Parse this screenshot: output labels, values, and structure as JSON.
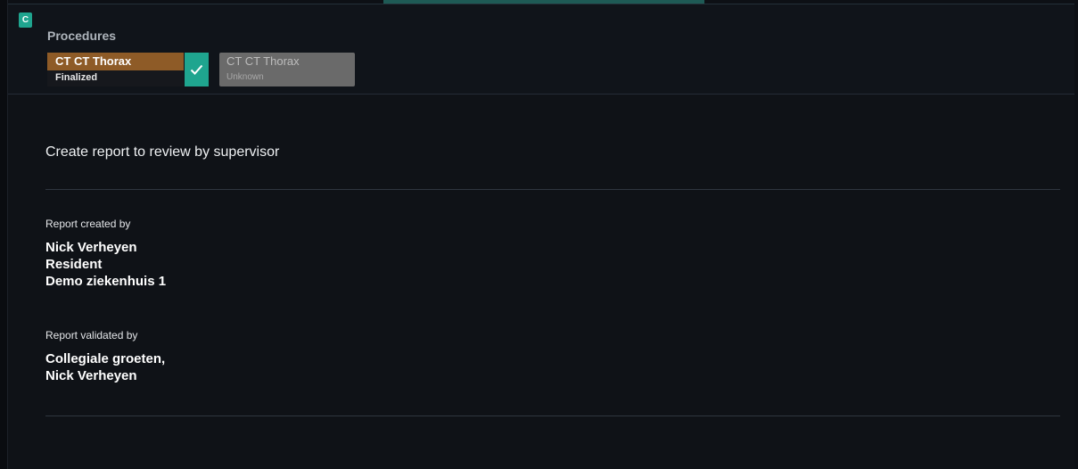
{
  "header": {
    "badge_letter": "C",
    "procedures_title": "Procedures",
    "procedures": [
      {
        "name": "CT CT Thorax",
        "status": "Finalized",
        "selected": true,
        "accent_color": "#8e5b27"
      },
      {
        "name": "CT CT Thorax",
        "status": "Unknown",
        "selected": false
      }
    ]
  },
  "report": {
    "heading": "Create report to review by supervisor",
    "created_by_label": "Report created by",
    "created_by_lines": [
      "Nick Verheyen",
      "Resident",
      "Demo ziekenhuis 1"
    ],
    "validated_by_label": "Report validated by",
    "validated_by_lines": [
      "Collegiale groeten,",
      "Nick Verheyen"
    ]
  },
  "colors": {
    "teal_accent": "#1fa58f",
    "background": "#0d1015"
  },
  "icons": {
    "check": "check-icon"
  }
}
